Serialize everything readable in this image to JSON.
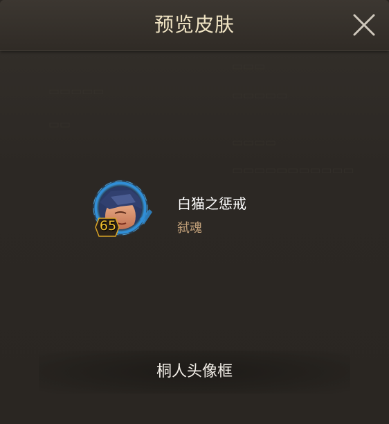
{
  "dialog": {
    "title": "预览皮肤",
    "close_icon": "close-icon"
  },
  "skin": {
    "name": "白猫之惩戒",
    "hero": "弑魂",
    "level": "65",
    "avatar_icon": "hero-portrait-avatar"
  },
  "footer": {
    "label": "桐人头像框"
  },
  "colors": {
    "title": "#efe3c3",
    "subtitle": "#bf9e78",
    "level": "#f2c12e",
    "ring": "#2f8fd8"
  }
}
